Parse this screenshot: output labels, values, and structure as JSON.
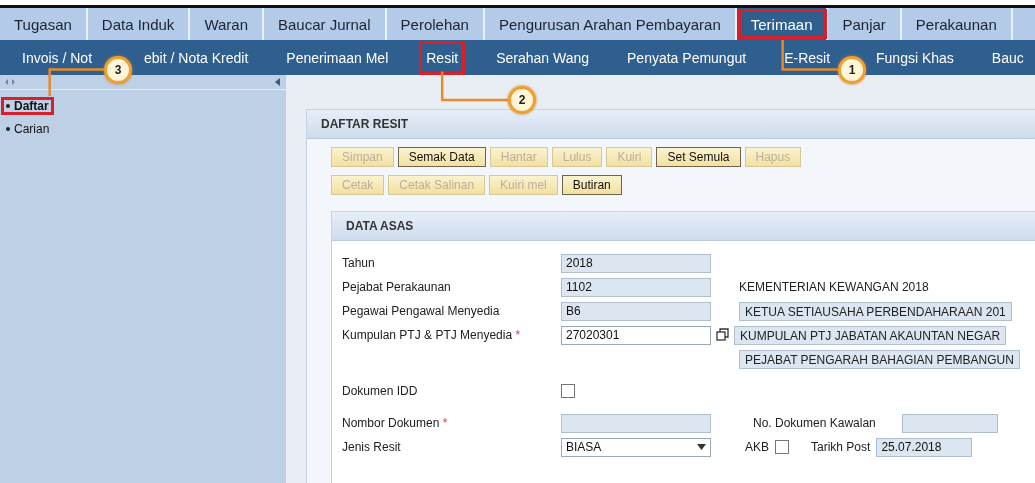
{
  "tabs": [
    {
      "label": "Tugasan",
      "selected": false,
      "highlighted": false
    },
    {
      "label": "Data Induk",
      "selected": false,
      "highlighted": false
    },
    {
      "label": "Waran",
      "selected": false,
      "highlighted": false
    },
    {
      "label": "Baucar Jurnal",
      "selected": false,
      "highlighted": false
    },
    {
      "label": "Perolehan",
      "selected": false,
      "highlighted": false
    },
    {
      "label": "Pengurusan Arahan Pembayaran",
      "selected": false,
      "highlighted": false
    },
    {
      "label": "Terimaan",
      "selected": true,
      "highlighted": true
    },
    {
      "label": "Panjar",
      "selected": false,
      "highlighted": false
    },
    {
      "label": "Perakaunan",
      "selected": false,
      "highlighted": false
    }
  ],
  "subnav": [
    {
      "kind": "link",
      "label": "Invois / Not",
      "highlighted": false
    },
    {
      "kind": "callout",
      "number": "3"
    },
    {
      "kind": "link",
      "label": "ebit / Nota Kredit",
      "highlighted": false
    },
    {
      "kind": "link",
      "label": "Penerimaan Mel",
      "highlighted": false
    },
    {
      "kind": "link",
      "label": "Resit",
      "highlighted": true
    },
    {
      "kind": "link",
      "label": "Serahan Wang",
      "highlighted": false
    },
    {
      "kind": "link",
      "label": "Penyata Pemungut",
      "highlighted": false
    },
    {
      "kind": "link",
      "label": "E-Resit",
      "highlighted": false
    },
    {
      "kind": "callout",
      "number": "1"
    },
    {
      "kind": "link",
      "label": "Fungsi Khas",
      "highlighted": false
    },
    {
      "kind": "link",
      "label": "Bauc",
      "highlighted": false
    }
  ],
  "sidebar": {
    "items": [
      {
        "label": "Daftar",
        "selected": true,
        "highlighted": true
      },
      {
        "label": "Carian",
        "selected": false,
        "highlighted": false
      }
    ]
  },
  "callouts": [
    {
      "number": "2"
    }
  ],
  "panel": {
    "title": "DAFTAR RESIT",
    "button_rows": [
      [
        {
          "label": "Simpan",
          "disabled": true
        },
        {
          "label": "Semak Data",
          "disabled": false
        },
        {
          "label": "Hantar",
          "disabled": true
        },
        {
          "label": "Lulus",
          "disabled": true
        },
        {
          "label": "Kuiri",
          "disabled": true
        },
        {
          "label": "Set Semula",
          "disabled": false
        },
        {
          "label": "Hapus",
          "disabled": true
        }
      ],
      [
        {
          "label": "Cetak",
          "disabled": true
        },
        {
          "label": "Cetak Salinan",
          "disabled": true
        },
        {
          "label": "Kuiri mel",
          "disabled": true
        },
        {
          "label": "Butiran",
          "disabled": false
        }
      ]
    ],
    "section": {
      "title": "DATA ASAS",
      "rows": [
        {
          "label": "Tahun",
          "control": {
            "kind": "text",
            "value": "2018",
            "readonly": true
          }
        },
        {
          "label": "Pejabat Perakaunan",
          "control": {
            "kind": "text",
            "value": "1102",
            "readonly": true
          },
          "description": {
            "kind": "plain",
            "text": "KEMENTERIAN KEWANGAN 2018"
          }
        },
        {
          "label": "Pegawai Pengawal Menyedia",
          "control": {
            "kind": "text",
            "value": "B6",
            "readonly": true
          },
          "description": {
            "kind": "field",
            "text": "KETUA SETIAUSAHA PERBENDAHARAAN 201"
          }
        },
        {
          "label": "Kumpulan PTJ & PTJ Menyedia",
          "required_mark": "*",
          "control": {
            "kind": "text",
            "value": "27020301",
            "readonly": false
          },
          "lookup": true,
          "description": {
            "kind": "field",
            "text": "KUMPULAN PTJ JABATAN AKAUNTAN NEGAR"
          }
        },
        {
          "description": {
            "kind": "field",
            "text": "PEJABAT PENGARAH BAHAGIAN PEMBANGUN"
          }
        },
        {
          "label": "Dokumen IDD",
          "control": {
            "kind": "checkbox",
            "checked": false
          }
        },
        {
          "label": "Nombor Dokumen",
          "required_mark": "*",
          "control": {
            "kind": "text",
            "readonly": true
          },
          "extras": [
            {
              "kind": "label",
              "text": "No. Dokumen Kawalan"
            },
            {
              "kind": "text",
              "readonly": true
            }
          ]
        },
        {
          "label": "Jenis Resit",
          "control": {
            "kind": "select",
            "value": "BIASA"
          },
          "extras": [
            {
              "kind": "checkbox",
              "label": "AKB",
              "checked": false
            },
            {
              "kind": "label",
              "text": "Tarikh Post"
            },
            {
              "kind": "text",
              "value": "25.07.2018",
              "readonly": true
            }
          ]
        }
      ]
    }
  }
}
